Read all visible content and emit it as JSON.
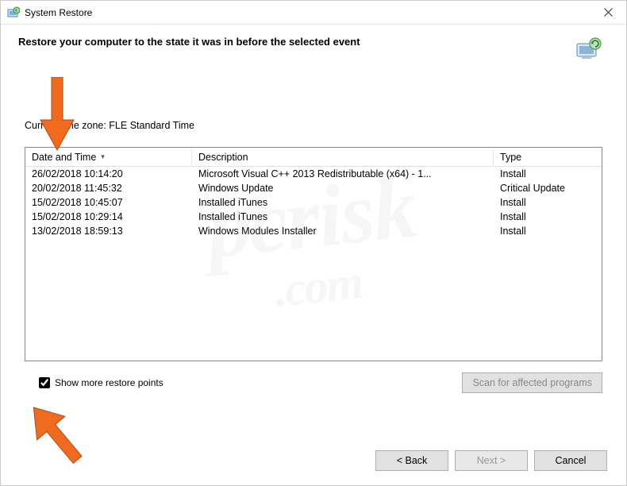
{
  "window": {
    "title": "System Restore"
  },
  "header": {
    "text": "Restore your computer to the state it was in before the selected event"
  },
  "timezone_label": "Current time zone: FLE Standard Time",
  "table": {
    "columns": {
      "date": "Date and Time",
      "desc": "Description",
      "type": "Type"
    },
    "rows": [
      {
        "date": "26/02/2018 10:14:20",
        "desc": "Microsoft Visual C++ 2013 Redistributable (x64) - 1...",
        "type": "Install"
      },
      {
        "date": "20/02/2018 11:45:32",
        "desc": "Windows Update",
        "type": "Critical Update"
      },
      {
        "date": "15/02/2018 10:45:07",
        "desc": "Installed iTunes",
        "type": "Install"
      },
      {
        "date": "15/02/2018 10:29:14",
        "desc": "Installed iTunes",
        "type": "Install"
      },
      {
        "date": "13/02/2018 18:59:13",
        "desc": "Windows Modules Installer",
        "type": "Install"
      }
    ]
  },
  "checkbox": {
    "label": "Show more restore points",
    "checked": true
  },
  "buttons": {
    "scan": "Scan for affected programs",
    "back": "< Back",
    "next": "Next >",
    "cancel": "Cancel"
  },
  "watermark": {
    "main": "pcrisk",
    "sub": ".com"
  }
}
